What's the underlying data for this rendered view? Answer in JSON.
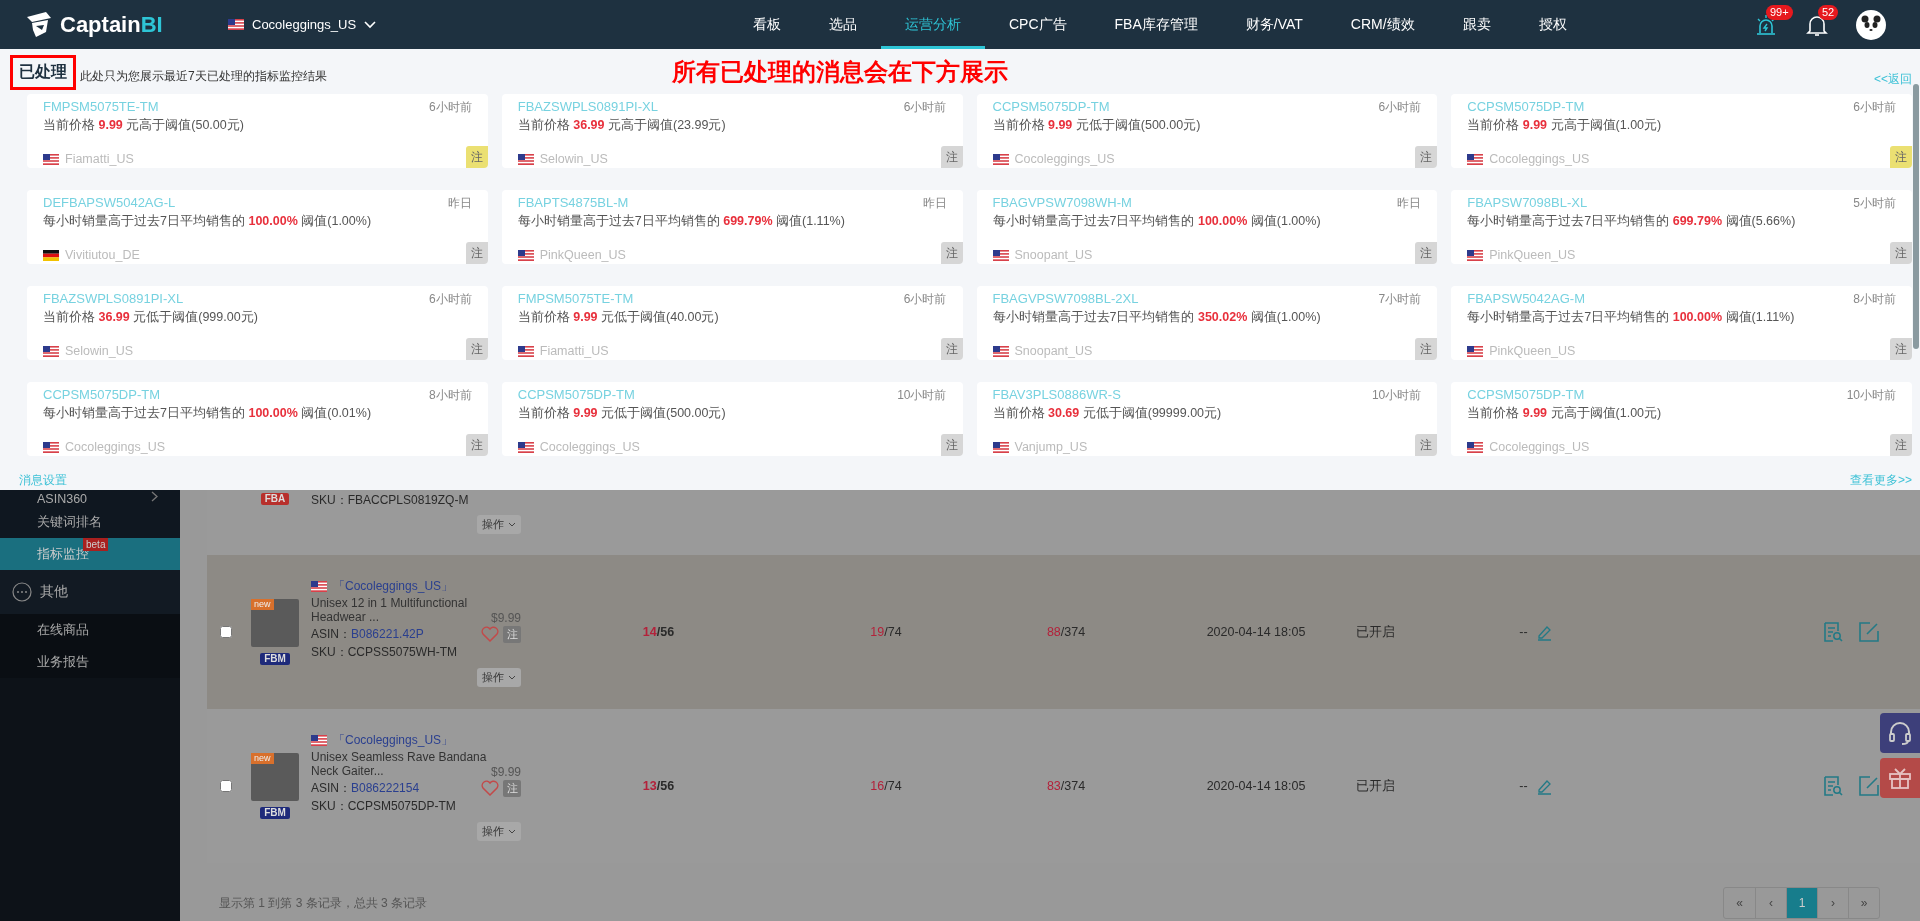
{
  "top_bar": {
    "logo": {
      "name": "Captain",
      "accent": "BI"
    },
    "store_selector": {
      "name": "Cocoleggings_US"
    },
    "nav": [
      {
        "label": "看板",
        "selected": false
      },
      {
        "label": "选品",
        "selected": false
      },
      {
        "label": "运营分析",
        "selected": true
      },
      {
        "label": "CPC广告",
        "selected": false
      },
      {
        "label": "FBA库存管理",
        "selected": false
      },
      {
        "label": "财务/VAT",
        "selected": false
      },
      {
        "label": "CRM/绩效",
        "selected": false
      },
      {
        "label": "跟卖",
        "selected": false
      },
      {
        "label": "授权",
        "selected": false
      }
    ],
    "alerts_badge": "99+",
    "notifications_badge": "52"
  },
  "panel": {
    "title": "已处理",
    "description": "此处只为您展示最近7天已处理的指标监控结果",
    "annotation": "所有已处理的消息会在下方展示",
    "back_link": "<<返回",
    "cards": [
      {
        "sku": "FMPSM5075TE-TM",
        "time": "6小时前",
        "message": {
          "prefix": "当前价格",
          "value": "9.99",
          "suffix": "元高于阈值(50.00元)"
        },
        "kind": "us",
        "store": "Fiamatti_US",
        "tag": "注",
        "noted": true
      },
      {
        "sku": "FBAZSWPLS0891PI-XL",
        "time": "6小时前",
        "message": {
          "prefix": "当前价格",
          "value": "36.99",
          "suffix": "元高于阈值(23.99元)"
        },
        "kind": "us",
        "store": "Selowin_US",
        "tag": "注",
        "noted": false
      },
      {
        "sku": "CCPSM5075DP-TM",
        "time": "6小时前",
        "message": {
          "prefix": "当前价格",
          "value": "9.99",
          "suffix": "元低于阈值(500.00元)"
        },
        "kind": "us",
        "store": "Cocoleggings_US",
        "tag": "注",
        "noted": false
      },
      {
        "sku": "CCPSM5075DP-TM",
        "time": "6小时前",
        "message": {
          "prefix": "当前价格",
          "value": "9.99",
          "suffix": "元高于阈值(1.00元)"
        },
        "kind": "us",
        "store": "Cocoleggings_US",
        "tag": "注",
        "noted": true
      },
      {
        "sku": "DEFBAPSW5042AG-L",
        "time": "昨日",
        "message": {
          "prefix": "每小时销量高于过去7日平均销售的",
          "value": "100.00%",
          "suffix": "阈值(1.00%)"
        },
        "kind": "de",
        "store": "Vivitiutou_DE",
        "tag": "注",
        "noted": false
      },
      {
        "sku": "FBAPTS4875BL-M",
        "time": "昨日",
        "message": {
          "prefix": "每小时销量高于过去7日平均销售的",
          "value": "699.79%",
          "suffix": "阈值(1.11%)"
        },
        "kind": "us",
        "store": "PinkQueen_US",
        "tag": "注",
        "noted": false
      },
      {
        "sku": "FBAGVPSW7098WH-M",
        "time": "昨日",
        "message": {
          "prefix": "每小时销量高于过去7日平均销售的",
          "value": "100.00%",
          "suffix": "阈值(1.00%)"
        },
        "kind": "us",
        "store": "Snoopant_US",
        "tag": "注",
        "noted": false
      },
      {
        "sku": "FBAPSW7098BL-XL",
        "time": "5小时前",
        "message": {
          "prefix": "每小时销量高于过去7日平均销售的",
          "value": "699.79%",
          "suffix": "阈值(5.66%)"
        },
        "kind": "us",
        "store": "PinkQueen_US",
        "tag": "注",
        "noted": false
      },
      {
        "sku": "FBAZSWPLS0891PI-XL",
        "time": "6小时前",
        "message": {
          "prefix": "当前价格",
          "value": "36.99",
          "suffix": "元低于阈值(999.00元)"
        },
        "kind": "us",
        "store": "Selowin_US",
        "tag": "注",
        "noted": false
      },
      {
        "sku": "FMPSM5075TE-TM",
        "time": "6小时前",
        "message": {
          "prefix": "当前价格",
          "value": "9.99",
          "suffix": "元低于阈值(40.00元)"
        },
        "kind": "us",
        "store": "Fiamatti_US",
        "tag": "注",
        "noted": false
      },
      {
        "sku": "FBAGVPSW7098BL-2XL",
        "time": "7小时前",
        "message": {
          "prefix": "每小时销量高于过去7日平均销售的",
          "value": "350.02%",
          "suffix": "阈值(1.00%)"
        },
        "kind": "us",
        "store": "Snoopant_US",
        "tag": "注",
        "noted": false
      },
      {
        "sku": "FBAPSW5042AG-M",
        "time": "8小时前",
        "message": {
          "prefix": "每小时销量高于过去7日平均销售的",
          "value": "100.00%",
          "suffix": "阈值(1.11%)"
        },
        "kind": "us",
        "store": "PinkQueen_US",
        "tag": "注",
        "noted": false
      },
      {
        "sku": "CCPSM5075DP-TM",
        "time": "8小时前",
        "message": {
          "prefix": "每小时销量高于过去7日平均销售的",
          "value": "100.00%",
          "suffix": "阈值(0.01%)"
        },
        "kind": "us",
        "store": "Cocoleggings_US",
        "tag": "注",
        "noted": false
      },
      {
        "sku": "CCPSM5075DP-TM",
        "time": "10小时前",
        "message": {
          "prefix": "当前价格",
          "value": "9.99",
          "suffix": "元低于阈值(500.00元)"
        },
        "kind": "us",
        "store": "Cocoleggings_US",
        "tag": "注",
        "noted": false
      },
      {
        "sku": "FBAV3PLS0886WR-S",
        "time": "10小时前",
        "message": {
          "prefix": "当前价格",
          "value": "30.69",
          "suffix": "元低于阈值(99999.00元)"
        },
        "kind": "us",
        "store": "Vanjump_US",
        "tag": "注",
        "noted": false
      },
      {
        "sku": "CCPSM5075DP-TM",
        "time": "10小时前",
        "message": {
          "prefix": "当前价格",
          "value": "9.99",
          "suffix": "元高于阈值(1.00元)"
        },
        "kind": "us",
        "store": "Cocoleggings_US",
        "tag": "注",
        "noted": false
      }
    ],
    "settings_link": "消息设置",
    "more_link": "查看更多>>"
  },
  "sidebar": {
    "items": [
      {
        "label": "ASIN360",
        "kind": "item",
        "expandable": true,
        "selected": false
      },
      {
        "label": "关键词排名",
        "kind": "item",
        "expandable": false,
        "selected": false
      },
      {
        "label": "指标监控",
        "kind": "item",
        "expandable": false,
        "selected": true,
        "badge": "beta"
      },
      {
        "label": "其他",
        "kind": "group",
        "expandable": false,
        "selected": false,
        "children": [
          {
            "label": "在线商品",
            "kind": "item",
            "expandable": false,
            "selected": false
          },
          {
            "label": "业务报告",
            "kind": "item",
            "expandable": false,
            "selected": false
          }
        ]
      }
    ]
  },
  "table": {
    "rows": [
      {
        "kind": "partial",
        "fulfillment": {
          "label": "FBA",
          "color": "#b8302c"
        },
        "sku_label": "SKU：",
        "sku": "FBACCPLS0819ZQ-M",
        "action": "操作"
      },
      {
        "kind": "full",
        "checked": false,
        "new_badge": "new",
        "fulfillment": {
          "label": "FBM",
          "color": "#1e2a7a"
        },
        "store": "「Cocoleggings_US」",
        "title": "Unisex 12 in 1 Multifunctional Headwear ...",
        "price": "$9.99",
        "asin_label": "ASIN：",
        "asin": "B086221.42P",
        "sku_label": "SKU：",
        "sku": "CCPSS5075WH-TM",
        "note": "注",
        "action": "操作",
        "ratios": [
          {
            "hit": "14",
            "rest": "/56",
            "bold": true
          },
          {
            "hit": "19",
            "rest": "/74",
            "bold": false
          },
          {
            "hit": "88",
            "rest": "/374",
            "bold": false
          }
        ],
        "date": "2020-04-14 18:05",
        "status": "已开启",
        "remark": "--",
        "highlighted": true
      },
      {
        "kind": "full",
        "checked": false,
        "new_badge": "new",
        "fulfillment": {
          "label": "FBM",
          "color": "#1e2a7a"
        },
        "store": "「Cocoleggings_US」",
        "title": "Unisex Seamless Rave Bandana Neck Gaiter...",
        "price": "$9.99",
        "asin_label": "ASIN：",
        "asin": "B086222154",
        "sku_label": "SKU：",
        "sku": "CCPSM5075DP-TM",
        "note": "注",
        "action": "操作",
        "ratios": [
          {
            "hit": "13",
            "rest": "/56",
            "bold": true
          },
          {
            "hit": "16",
            "rest": "/74",
            "bold": false
          },
          {
            "hit": "83",
            "rest": "/374",
            "bold": false
          }
        ],
        "date": "2020-04-14 18:05",
        "status": "已开启",
        "remark": "--",
        "highlighted": false
      }
    ],
    "footer": "显示第 1 到第 3 条记录，总共 3 条记录",
    "pagination": [
      {
        "label": "«",
        "selected": false
      },
      {
        "label": "‹",
        "selected": false
      },
      {
        "label": "1",
        "selected": true
      },
      {
        "label": "›",
        "selected": false
      },
      {
        "label": "»",
        "selected": false
      }
    ]
  }
}
